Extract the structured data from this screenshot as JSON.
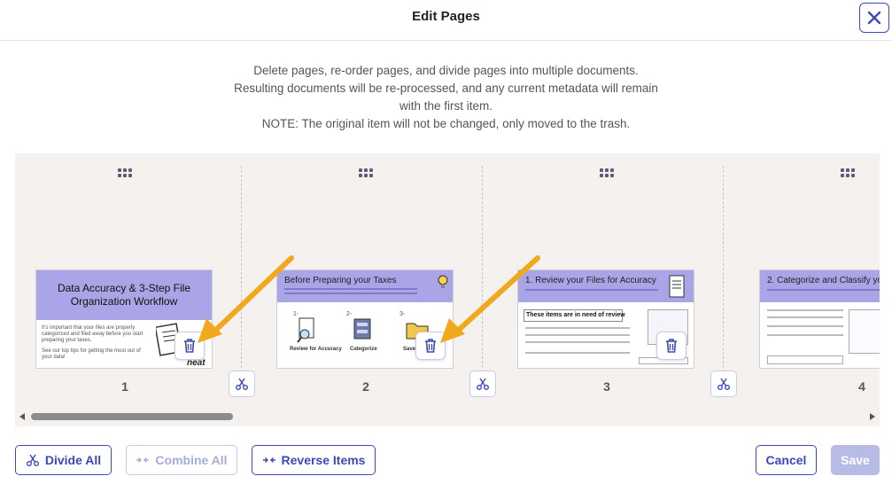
{
  "header": {
    "title": "Edit Pages"
  },
  "description": {
    "line1": "Delete pages, re-order pages, and divide pages into multiple documents.",
    "line2": "Resulting documents will be re-processed, and any current metadata will remain",
    "line3": "with the first item.",
    "line4": "NOTE: The original item will not be changed, only moved to the trash."
  },
  "pages": [
    {
      "number": "1",
      "title_line1": "Data Accuracy & 3-Step File",
      "title_line2": "Organization Workflow",
      "body1": "It's important that your files are properly categorized and filed away before you start preparing your taxes.",
      "body2": "See our top tips for getting the most out of your data!",
      "logo": "neat"
    },
    {
      "number": "2",
      "title": "Before Preparing your Taxes",
      "steps": [
        "1-",
        "2-",
        "3-"
      ],
      "step_labels": [
        "Review for Accuracy",
        "Categorize",
        "Save Fi"
      ]
    },
    {
      "number": "3",
      "title": "1. Review your Files for Accuracy",
      "callout": "These items are in need of review"
    },
    {
      "number": "4",
      "title": "2. Categorize and Classify your"
    }
  ],
  "footer": {
    "divide_all": "Divide All",
    "combine_all": "Combine All",
    "reverse_items": "Reverse Items",
    "cancel": "Cancel",
    "save": "Save"
  },
  "colors": {
    "accent": "#3b48b8",
    "thumb_band": "#a9a5e6",
    "arrow": "#f2a81d"
  },
  "scroll": {
    "position_fraction": 0.0,
    "visible_fraction": 0.24
  }
}
